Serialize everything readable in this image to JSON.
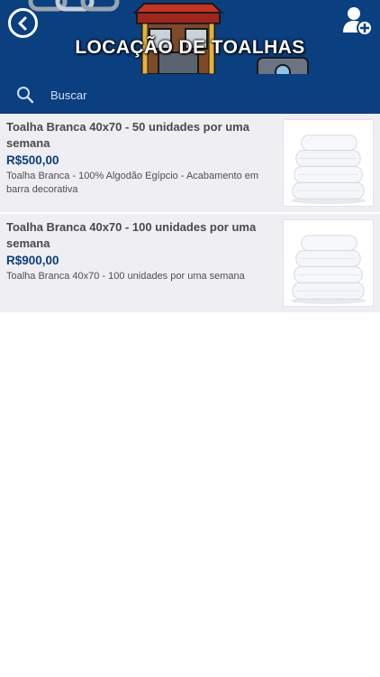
{
  "header": {
    "title": "LOCAÇÃO DE TOALHAS",
    "back_icon": "back-arrow-icon",
    "add_user_icon": "add-user-icon"
  },
  "search": {
    "placeholder": "Buscar",
    "value": ""
  },
  "products": [
    {
      "title": "Toalha Branca 40x70 - 50 unidades por uma semana",
      "price": "R$500,00",
      "description": "Toalha Branca - 100% Algodão Egípcio - Acabamento em barra decorativa",
      "image_icon": "towel-stack-image"
    },
    {
      "title": "Toalha Branca 40x70 - 100 unidades por uma semana",
      "price": "R$900,00",
      "description": "Toalha Branca 40x70 - 100 unidades por uma semana",
      "image_icon": "towel-stack-image"
    }
  ],
  "colors": {
    "header_bg": "#0a3f80",
    "price": "#0a3f80",
    "item_bg": "#eeeef3"
  }
}
